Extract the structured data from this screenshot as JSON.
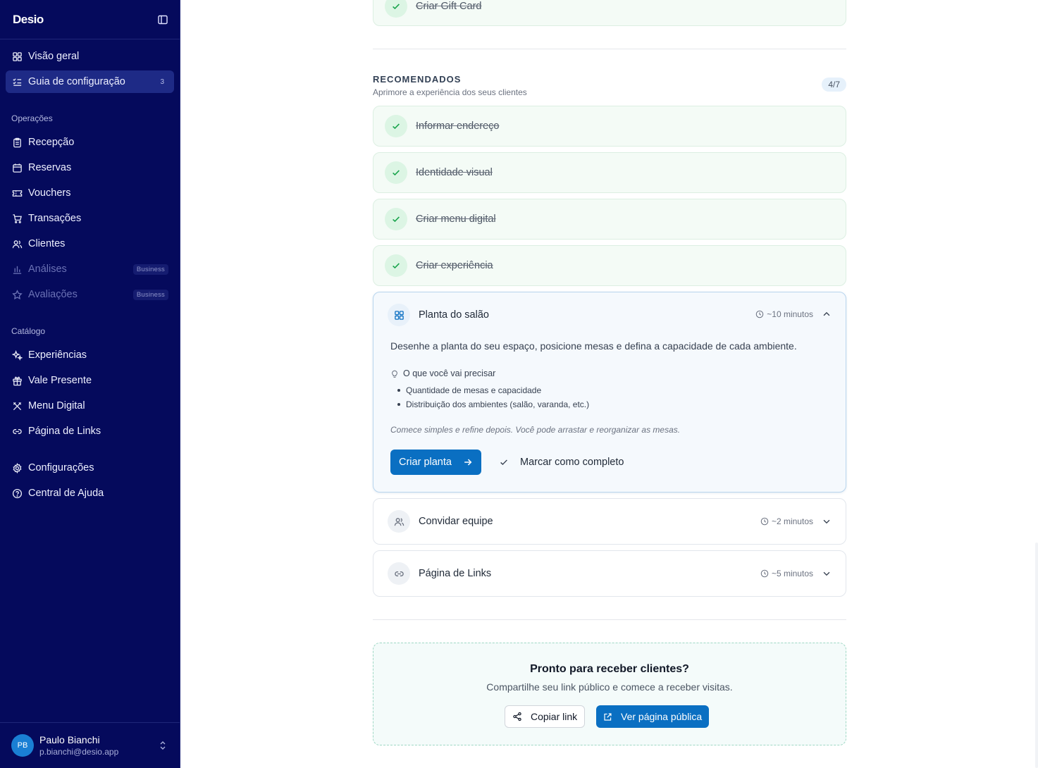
{
  "sidebar": {
    "logo": "Desio",
    "nav_top": [
      {
        "label": "Visão geral",
        "icon": "dashboard-icon"
      },
      {
        "label": "Guia de configuração",
        "icon": "checklist-icon",
        "count": "3",
        "active": true
      }
    ],
    "operacoes_label": "Operações",
    "operacoes": [
      {
        "label": "Recepção",
        "icon": "clipboard-icon"
      },
      {
        "label": "Reservas",
        "icon": "calendar-icon"
      },
      {
        "label": "Vouchers",
        "icon": "ticket-icon"
      },
      {
        "label": "Transações",
        "icon": "cart-icon"
      },
      {
        "label": "Clientes",
        "icon": "users-icon"
      },
      {
        "label": "Análises",
        "icon": "bar-chart-icon",
        "badge": "Business",
        "disabled": true
      },
      {
        "label": "Avaliações",
        "icon": "star-icon",
        "badge": "Business",
        "disabled": true
      }
    ],
    "catalogo_label": "Catálogo",
    "catalogo": [
      {
        "label": "Experiências",
        "icon": "sparkles-icon"
      },
      {
        "label": "Vale Presente",
        "icon": "gift-icon"
      },
      {
        "label": "Menu Digital",
        "icon": "utensils-icon"
      },
      {
        "label": "Página de Links",
        "icon": "link-icon"
      }
    ],
    "bottom": [
      {
        "label": "Configurações",
        "icon": "gear-icon"
      },
      {
        "label": "Central de Ajuda",
        "icon": "help-icon"
      }
    ],
    "user": {
      "initials": "PB",
      "name": "Paulo Bianchi",
      "email": "p.bianchi@desio.app"
    }
  },
  "top_done": {
    "title": "Criar Gift Card"
  },
  "recomendados": {
    "title": "RECOMENDADOS",
    "subtitle": "Aprimore a experiência dos seus clientes",
    "progress": "4/7",
    "done": [
      "Informar endereço",
      "Identidade visual",
      "Criar menu digital",
      "Criar experiência"
    ],
    "expanded": {
      "title": "Planta do salão",
      "time": "~10 minutos",
      "description": "Desenhe a planta do seu espaço, posicione mesas e defina a capacidade de cada ambiente.",
      "needs_title": "O que você vai precisar",
      "needs": [
        "Quantidade de mesas e capacidade",
        "Distribuição dos ambientes (salão, varanda, etc.)"
      ],
      "tip": "Comece simples e refine depois. Você pode arrastar e reorganizar as mesas.",
      "primary": "Criar planta",
      "secondary": "Marcar como completo"
    },
    "collapsed": [
      {
        "title": "Convidar equipe",
        "time": "~2 minutos",
        "icon": "users-icon"
      },
      {
        "title": "Página de Links",
        "time": "~5 minutos",
        "icon": "link-icon"
      }
    ]
  },
  "cta": {
    "title": "Pronto para receber clientes?",
    "subtitle": "Compartilhe seu link público e comece a receber visitas.",
    "copy": "Copiar link",
    "view": "Ver página pública"
  },
  "colors": {
    "sidebar": "#050a5c",
    "accent": "#0a6fc2",
    "success": "#16a34a"
  }
}
